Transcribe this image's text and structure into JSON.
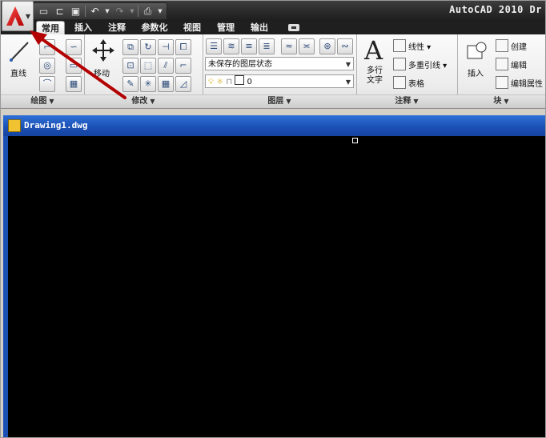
{
  "app": {
    "title": "AutoCAD 2010  Dr",
    "app_button_icon": "autocad-logo-icon"
  },
  "quick_access": {
    "icons": [
      "new-icon",
      "open-icon",
      "save-icon",
      "undo-icon",
      "redo-icon",
      "plot-icon"
    ]
  },
  "tabs": [
    {
      "label": "常用",
      "active": true
    },
    {
      "label": "插入"
    },
    {
      "label": "注释"
    },
    {
      "label": "参数化"
    },
    {
      "label": "视图"
    },
    {
      "label": "管理"
    },
    {
      "label": "输出"
    }
  ],
  "ribbon": {
    "draw": {
      "title": "绘图",
      "line_label": "直线"
    },
    "modify": {
      "title": "修改",
      "move_label": "移动"
    },
    "layers": {
      "title": "图层",
      "layer_state": "未保存的图层状态",
      "current_layer": "0"
    },
    "annotation": {
      "title": "注释",
      "mtext_label": "多行\n文字",
      "mtext_line1": "多行",
      "mtext_line2": "文字",
      "linear_label": "线性",
      "mleader_label": "多重引线",
      "table_label": "表格"
    },
    "block": {
      "title": "块",
      "insert_label": "插入",
      "create_label": "创建",
      "edit_label": "编辑",
      "edit_attr_label": "编辑属性"
    }
  },
  "document": {
    "title": "Drawing1.dwg"
  },
  "colors": {
    "annotation_arrow": "#b30000",
    "doc_titlebar": "#1a4fb3",
    "canvas": "#000000"
  }
}
